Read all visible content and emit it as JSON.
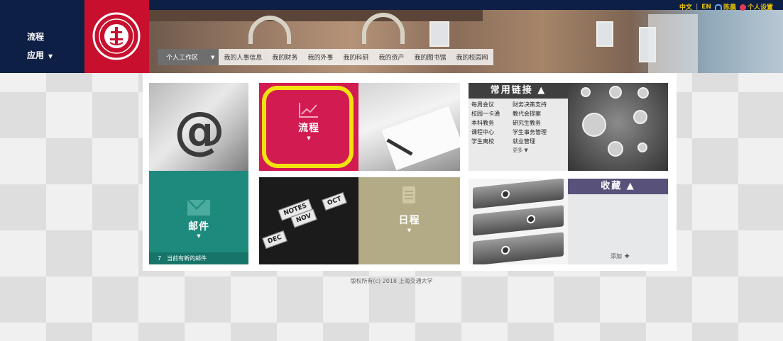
{
  "left_nav": {
    "process": "流程",
    "apps": "应用",
    "apps_caret": "▼"
  },
  "top_right": {
    "lang_zh": "中文",
    "separator": "|",
    "lang_en": "EN",
    "user": "陈晨",
    "settings": "个人设置"
  },
  "tabs": [
    {
      "label": "个人工作区",
      "active": true
    },
    {
      "label": "我的人事信息"
    },
    {
      "label": "我的财务"
    },
    {
      "label": "我的外事"
    },
    {
      "label": "我的科研"
    },
    {
      "label": "我的资产"
    },
    {
      "label": "我的图书馆"
    },
    {
      "label": "我的校园网"
    }
  ],
  "tiles": {
    "process": {
      "label": "流程",
      "caret": "▼"
    },
    "mail": {
      "label": "邮件",
      "caret": "▼",
      "count": "7",
      "status": "当前有新的邮件"
    },
    "schedule": {
      "label": "日程",
      "caret": "▼"
    }
  },
  "links": {
    "title": "常用链接 ▲",
    "items": [
      "每周会议",
      "财务决策支持",
      "校园一卡通",
      "教代会提案",
      "本科教务",
      "研究生教务",
      "课程中心",
      "学生事务管理",
      "学生离校",
      "就业管理"
    ],
    "more": "更多 ▼"
  },
  "favorites": {
    "title": "收藏 ▲",
    "add": "添加"
  },
  "calendar_photo": {
    "months": [
      "DEC",
      "NOV",
      "OCT",
      "NOTES"
    ]
  },
  "footer": {
    "copyright": "版权所有(c) 2018 上海交通大学"
  },
  "colors": {
    "navy": "#0e1f45",
    "brand_red": "#c8102e",
    "process_tile": "#d11b51",
    "highlight": "#f2e20e",
    "mail_tile": "#1e8a7e",
    "schedule_tile": "#b3ab86",
    "favorites_header": "#58527a",
    "links_header": "#3f3f3f"
  },
  "icons": {
    "process": "line-chart-icon",
    "mail": "envelope-icon",
    "schedule": "notepad-icon",
    "user": "user-icon",
    "settings": "gear-icon"
  }
}
